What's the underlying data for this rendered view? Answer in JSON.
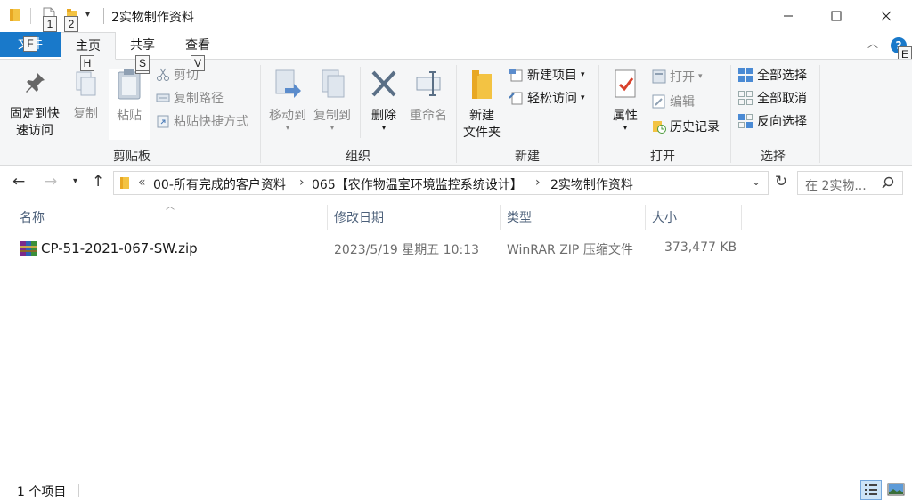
{
  "window": {
    "title": "2实物制作资料"
  },
  "keytips": {
    "qa1": "1",
    "qa2": "2",
    "file": "F",
    "home": "H",
    "share": "S",
    "view": "V",
    "help": "E"
  },
  "tabs": {
    "file": "文件",
    "home": "主页",
    "share": "共享",
    "view": "查看",
    "help_glyph": "?"
  },
  "ribbon": {
    "clipboard": {
      "label": "剪贴板",
      "pin": "固定到快速访问",
      "pin_l1": "固定到快",
      "pin_l2": "速访问",
      "copy": "复制",
      "paste": "粘贴",
      "cut": "剪切",
      "copy_path": "复制路径",
      "paste_shortcut": "粘贴快捷方式"
    },
    "organize": {
      "label": "组织",
      "move_to": "移动到",
      "copy_to": "复制到",
      "delete": "删除",
      "rename": "重命名"
    },
    "new": {
      "label": "新建",
      "new_folder_l1": "新建",
      "new_folder_l2": "文件夹",
      "new_item": "新建项目",
      "easy_access": "轻松访问"
    },
    "open": {
      "label": "打开",
      "properties": "属性",
      "open": "打开",
      "edit": "编辑",
      "history": "历史记录"
    },
    "select": {
      "label": "选择",
      "select_all": "全部选择",
      "select_none": "全部取消",
      "invert": "反向选择"
    }
  },
  "address": {
    "overflow": "«",
    "crumbs": [
      "00-所有完成的客户资料",
      "065【农作物温室环境监控系统设计】",
      "2实物制作资料"
    ],
    "search_placeholder": "在 2实物..."
  },
  "columns": {
    "name": "名称",
    "date": "修改日期",
    "type": "类型",
    "size": "大小"
  },
  "files": [
    {
      "name": "CP-51-2021-067-SW.zip",
      "date": "2023/5/19 星期五 10:13",
      "type": "WinRAR ZIP 压缩文件",
      "size": "373,477 KB"
    }
  ],
  "status": {
    "count": "1 个项目"
  },
  "colors": {
    "accent": "#1979ca",
    "ribbon_bg": "#f5f6f7",
    "header_text": "#4c607a"
  }
}
